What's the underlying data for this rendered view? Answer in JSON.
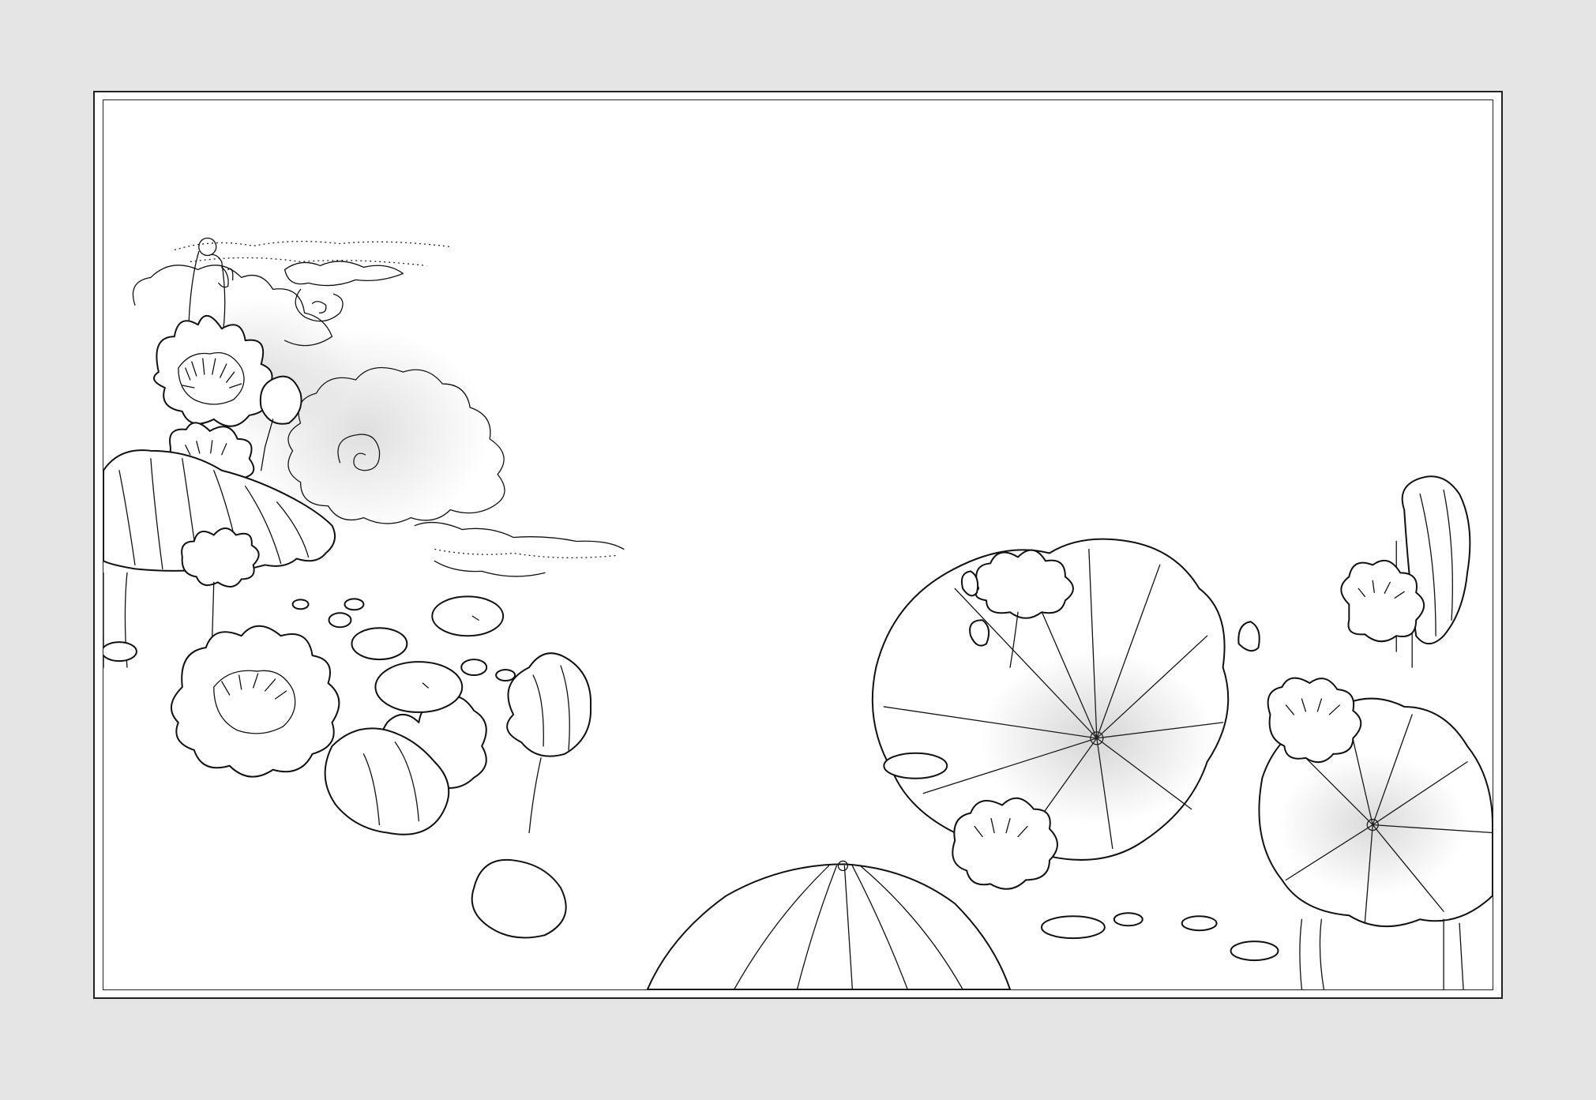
{
  "artwork": {
    "kind": "line-art illustration",
    "palette": {
      "background": "#e5e5e5",
      "paper": "#ffffff",
      "ink": "#111111"
    }
  }
}
